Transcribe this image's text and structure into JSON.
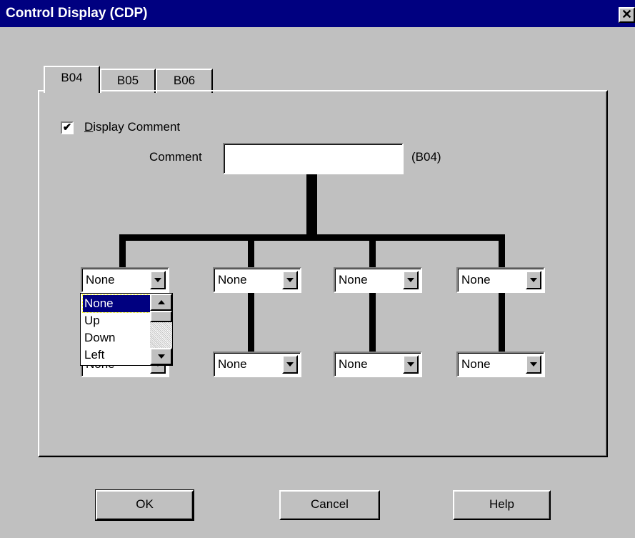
{
  "window": {
    "title": "Control Display (CDP)",
    "close_glyph": "✕"
  },
  "tabs": [
    {
      "label": "B04",
      "active": true
    },
    {
      "label": "B05",
      "active": false
    },
    {
      "label": "B06",
      "active": false
    }
  ],
  "display_comment": {
    "label": "Display Comment",
    "checked": true,
    "check_glyph": "✔"
  },
  "comment": {
    "label": "Comment",
    "value": "",
    "tag": "(B04)"
  },
  "combos": {
    "top": [
      "None",
      "None",
      "None",
      "None"
    ],
    "bottom": [
      "None",
      "None",
      "None",
      "None"
    ]
  },
  "dropdown": {
    "options": [
      "None",
      "Up",
      "Down",
      "Left"
    ],
    "selected": "None"
  },
  "buttons": {
    "ok": "OK",
    "cancel": "Cancel",
    "help": "Help"
  },
  "colors": {
    "titlebar": "#000080",
    "dialog": "#c0c0c0",
    "selection": "#000080"
  }
}
